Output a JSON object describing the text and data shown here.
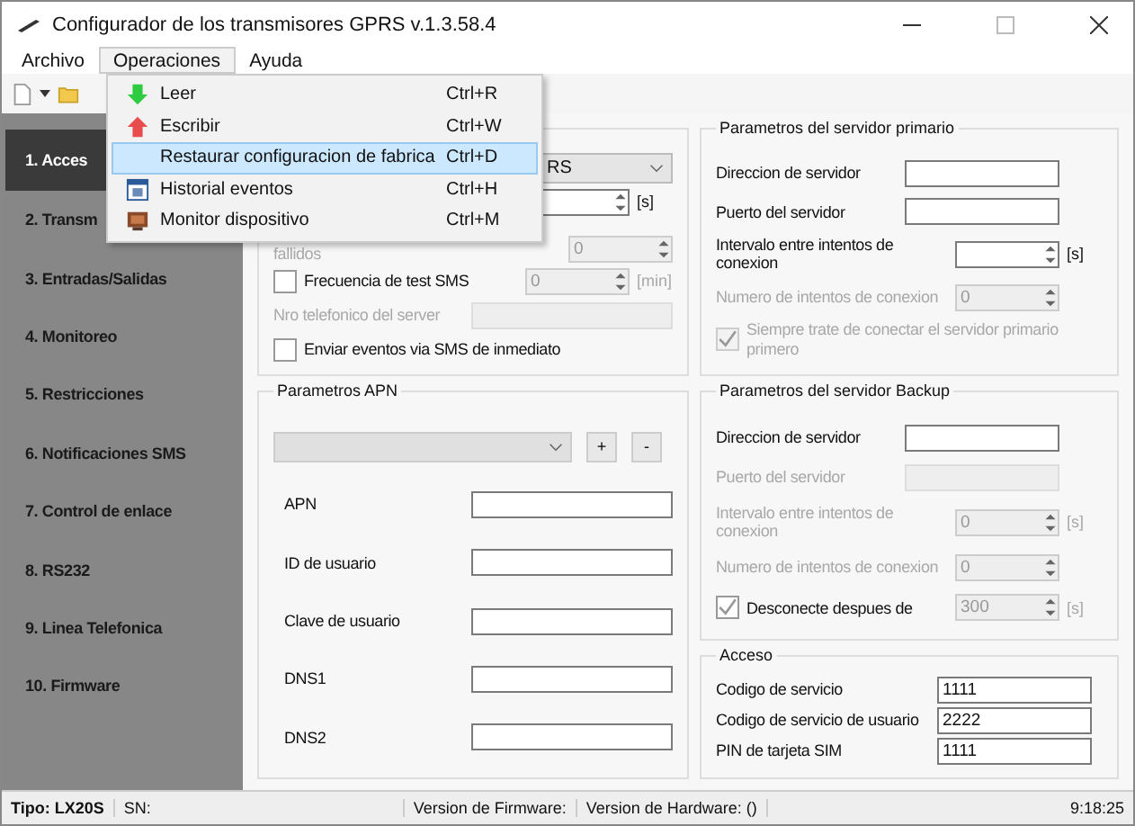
{
  "window": {
    "title": "Configurador de los transmisores GPRS v.1.3.58.4"
  },
  "menu_bar": [
    {
      "label": "Archivo",
      "selected": false
    },
    {
      "label": "Operaciones",
      "selected": true
    },
    {
      "label": "Ayuda",
      "selected": false
    }
  ],
  "dropdown_menu": [
    {
      "kind": "read",
      "label": "Leer",
      "shortcut": "Ctrl+R",
      "selected": false
    },
    {
      "kind": "write",
      "label": "Escribir",
      "shortcut": "Ctrl+W",
      "selected": false
    },
    {
      "kind": "plain",
      "label": "Restaurar configuracion de fabrica",
      "shortcut": "Ctrl+D",
      "selected": true
    },
    {
      "kind": "history",
      "label": "Historial eventos",
      "shortcut": "Ctrl+H",
      "selected": false
    },
    {
      "kind": "monitor",
      "label": "Monitor dispositivo",
      "shortcut": "Ctrl+M",
      "selected": false
    }
  ],
  "sidebar": [
    {
      "label": "1. Acces",
      "selected": true
    },
    {
      "label": "2. Transm",
      "selected": false
    },
    {
      "label": "3. Entradas/Salidas",
      "selected": false
    },
    {
      "label": "4. Monitoreo",
      "selected": false
    },
    {
      "label": "5. Restricciones",
      "selected": false
    },
    {
      "label": "6. Notificaciones SMS",
      "selected": false
    },
    {
      "label": "7. Control de enlace",
      "selected": false
    },
    {
      "label": "8. RS232",
      "selected": false
    },
    {
      "label": "9. Linea Telefonica",
      "selected": false
    },
    {
      "label": "10. Firmware",
      "selected": false
    }
  ],
  "left_column": [
    {
      "rows": [
        {
          "kind": "select",
          "value": "RS",
          "disabled": false
        },
        {
          "kind": "spinner",
          "value": "",
          "unit": "[s]",
          "disabled": false
        },
        {
          "kind": "spinner",
          "label": "fallidos",
          "value": "0",
          "disabled": true
        },
        {
          "kind": "spinner",
          "label": "Frecuencia de test SMS",
          "checked": false,
          "value": "0",
          "unit": "[min]",
          "disabled": true
        },
        {
          "kind": "field",
          "label": "Nro telefonico del server",
          "value": "",
          "disabled": true
        },
        {
          "kind": "check",
          "label": "Enviar eventos via SMS de inmediato",
          "checked": false,
          "disabled": false
        }
      ]
    },
    {
      "title": "Parametros APN",
      "rows": [
        {
          "kind": "combo",
          "buttons": [
            "+",
            "-"
          ],
          "disabled": false
        },
        {
          "kind": "field",
          "label": "APN",
          "value": "",
          "disabled": false
        },
        {
          "kind": "field",
          "label": "ID de usuario",
          "value": "",
          "disabled": false
        },
        {
          "kind": "field",
          "label": "Clave de usuario",
          "value": "",
          "disabled": false
        },
        {
          "kind": "field",
          "label": "DNS1",
          "value": "",
          "disabled": false
        },
        {
          "kind": "field",
          "label": "DNS2",
          "value": "",
          "disabled": false
        }
      ]
    }
  ],
  "right_column": [
    {
      "title": "Parametros del servidor primario",
      "rows": [
        {
          "kind": "field",
          "label": "Direccion de servidor",
          "value": "",
          "disabled": false
        },
        {
          "kind": "field",
          "label": "Puerto del servidor",
          "value": "",
          "disabled": false
        },
        {
          "kind": "spinner",
          "label": "Intervalo entre intentos de conexion",
          "value": "",
          "unit": "[s]",
          "disabled": false
        },
        {
          "kind": "spinner",
          "label": "Numero de intentos de conexion",
          "value": "0",
          "disabled": true
        },
        {
          "kind": "check",
          "label": "Siempre trate de conectar el servidor primario primero",
          "checked": true,
          "disabled": true
        }
      ]
    },
    {
      "title": "Parametros del servidor Backup",
      "rows": [
        {
          "kind": "field",
          "label": "Direccion de servidor",
          "value": "",
          "disabled": false
        },
        {
          "kind": "field",
          "label": "Puerto del servidor",
          "value": "",
          "disabled": true
        },
        {
          "kind": "spinner",
          "label": "Intervalo entre intentos de conexion",
          "value": "0",
          "unit": "[s]",
          "disabled": true
        },
        {
          "kind": "spinner",
          "label": "Numero de intentos de conexion",
          "value": "0",
          "disabled": true
        },
        {
          "kind": "spinner",
          "label": "Desconecte despues de",
          "checked": true,
          "value": "300",
          "unit": "[s]",
          "disabled": true
        }
      ]
    },
    {
      "title": "Acceso",
      "rows": [
        {
          "kind": "field",
          "label": "Codigo de servicio",
          "value": "1111",
          "disabled": false
        },
        {
          "kind": "field",
          "label": "Codigo de servicio de usuario",
          "value": "2222",
          "disabled": false
        },
        {
          "kind": "field",
          "label": "PIN de tarjeta SIM",
          "value": "1111",
          "disabled": false
        }
      ]
    }
  ],
  "status_bar": {
    "type": "Tipo: LX20S",
    "serial": "SN:",
    "firmware": "Version de Firmware:",
    "hardware": "Version de Hardware: ()",
    "time": "9:18:25"
  }
}
